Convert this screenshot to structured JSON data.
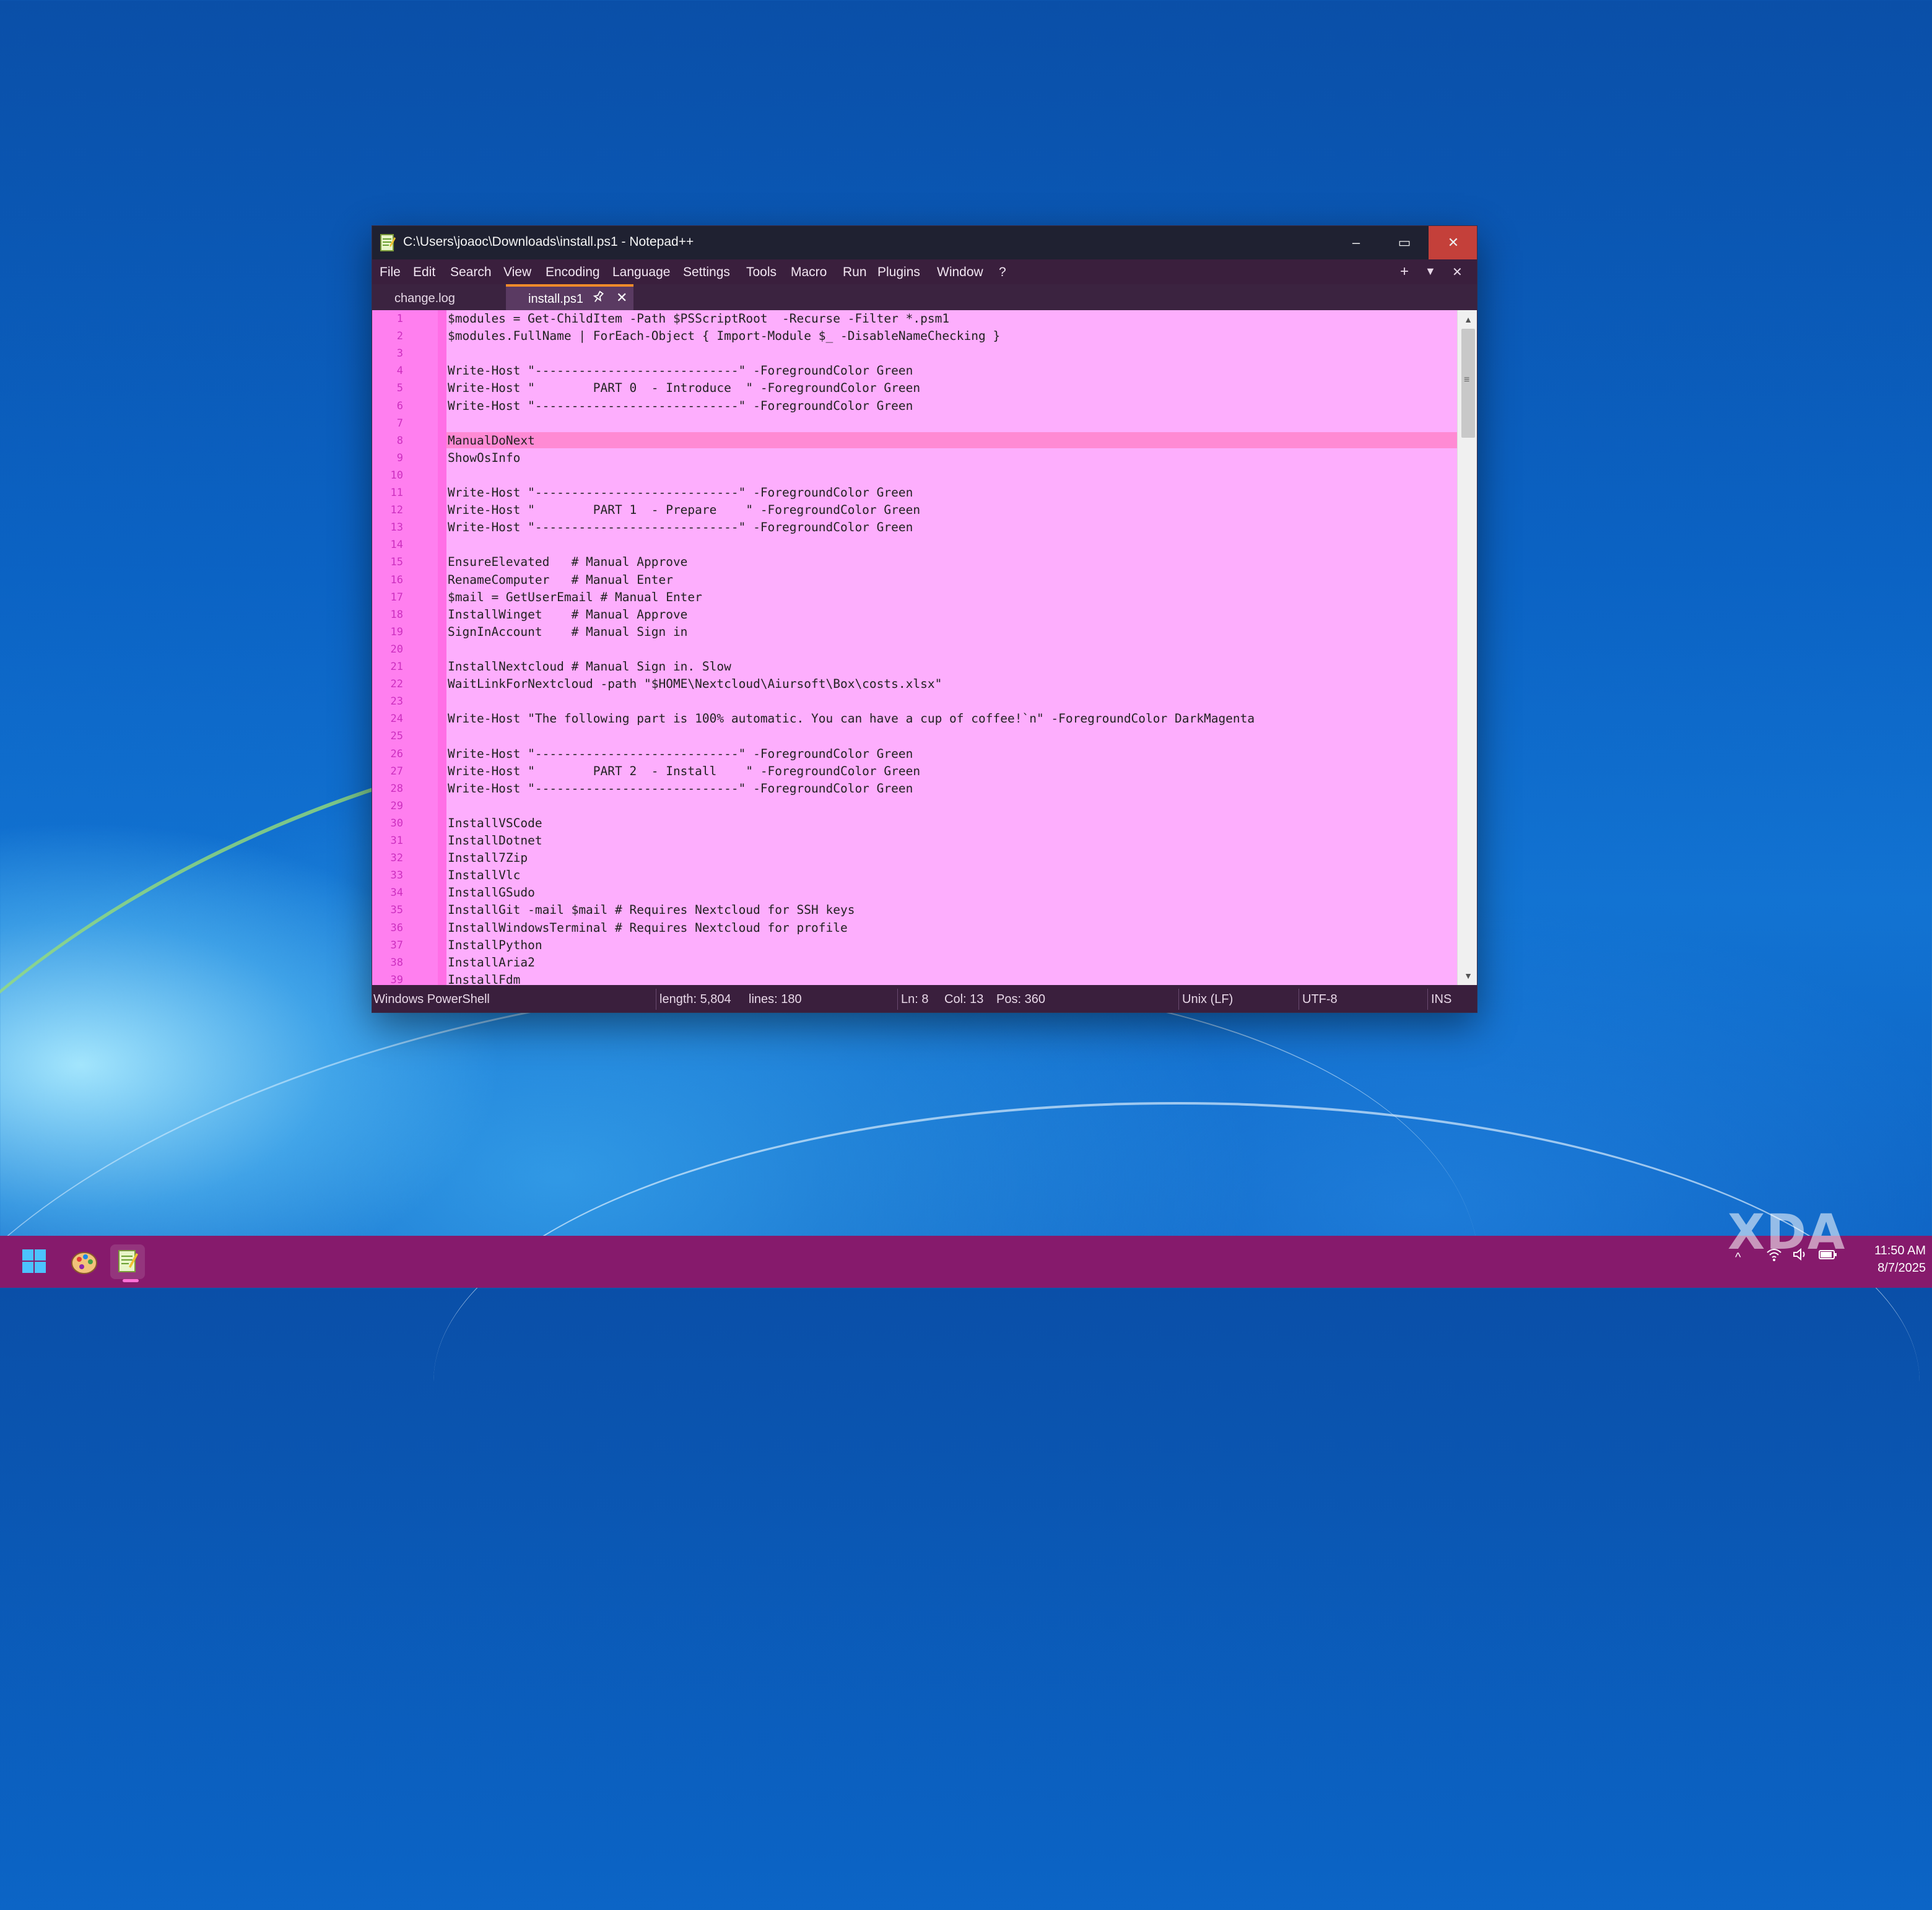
{
  "window": {
    "title": "C:\\Users\\joaoc\\Downloads\\install.ps1 - Notepad++",
    "minimize": "–",
    "maximize": "▭",
    "close": "✕"
  },
  "menu": {
    "items": [
      "File",
      "Edit",
      "Search",
      "View",
      "Encoding",
      "Language",
      "Settings",
      "Tools",
      "Macro",
      "Run",
      "Plugins",
      "Window",
      "?"
    ],
    "right": {
      "add": "+",
      "dropdown": "▼",
      "close": "✕"
    }
  },
  "tabs": [
    {
      "label": "change.log",
      "active": false
    },
    {
      "label": "install.ps1",
      "active": true,
      "pin": "📌",
      "close": "✕"
    }
  ],
  "editor": {
    "current_line": 8,
    "lines": [
      "$modules = Get-ChildItem -Path $PSScriptRoot  -Recurse -Filter *.psm1",
      "$modules.FullName | ForEach-Object { Import-Module $_ -DisableNameChecking }",
      "",
      "Write-Host \"----------------------------\" -ForegroundColor Green",
      "Write-Host \"        PART 0  - Introduce  \" -ForegroundColor Green",
      "Write-Host \"----------------------------\" -ForegroundColor Green",
      "",
      "ManualDoNext",
      "ShowOsInfo",
      "",
      "Write-Host \"----------------------------\" -ForegroundColor Green",
      "Write-Host \"        PART 1  - Prepare    \" -ForegroundColor Green",
      "Write-Host \"----------------------------\" -ForegroundColor Green",
      "",
      "EnsureElevated   # Manual Approve",
      "RenameComputer   # Manual Enter",
      "$mail = GetUserEmail # Manual Enter",
      "InstallWinget    # Manual Approve",
      "SignInAccount    # Manual Sign in",
      "",
      "InstallNextcloud # Manual Sign in. Slow",
      "WaitLinkForNextcloud -path \"$HOME\\Nextcloud\\Aiursoft\\Box\\costs.xlsx\"",
      "",
      "Write-Host \"The following part is 100% automatic. You can have a cup of coffee!`n\" -ForegroundColor DarkMagenta",
      "",
      "Write-Host \"----------------------------\" -ForegroundColor Green",
      "Write-Host \"        PART 2  - Install    \" -ForegroundColor Green",
      "Write-Host \"----------------------------\" -ForegroundColor Green",
      "",
      "InstallVSCode",
      "InstallDotnet",
      "Install7Zip",
      "InstallVlc",
      "InstallGSudo",
      "InstallGit -mail $mail # Requires Nextcloud for SSH keys",
      "InstallWindowsTerminal # Requires Nextcloud for profile",
      "InstallPython",
      "InstallAria2",
      "InstallFdm"
    ]
  },
  "status": {
    "language": "Windows PowerShell",
    "length": "length: 5,804",
    "lines": "lines: 180",
    "ln": "Ln: 8",
    "col": "Col: 13",
    "pos": "Pos: 360",
    "eol": "Unix (LF)",
    "encoding": "UTF-8",
    "mode": "INS"
  },
  "taskbar": {
    "time": "11:50 AM",
    "date": "8/7/2025",
    "tray_chevron": "^"
  },
  "watermark": "XDA",
  "colors": {
    "editor_bg": "#fdaefd",
    "current_line": "#ff8ad4",
    "gutter": "#ff7fef",
    "taskbar": "#861a6c",
    "titlebar": "#1f2131",
    "close_button": "#c4403a"
  }
}
